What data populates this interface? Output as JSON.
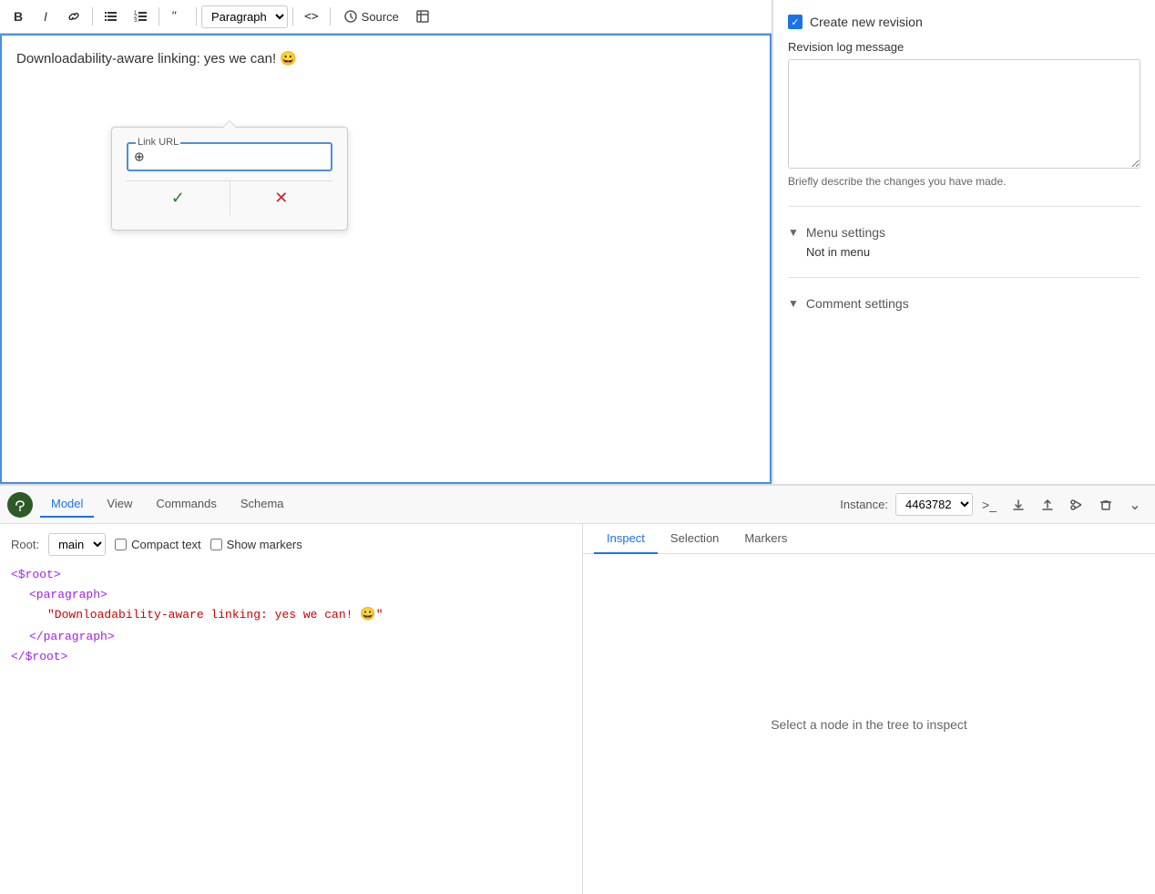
{
  "toolbar": {
    "bold_label": "B",
    "italic_label": "I",
    "link_label": "🔗",
    "bullet_list_label": "≡",
    "ordered_list_label": "≡↑",
    "blockquote_label": "❝",
    "paragraph_label": "Paragraph",
    "code_label": "<>",
    "source_label": "Source",
    "embed_label": "⊞"
  },
  "editor": {
    "content_text": "Downloadability-aware linking: yes we can! 😀",
    "link_url_label": "Link URL",
    "link_url_placeholder": "",
    "confirm_label": "✓",
    "cancel_label": "✕"
  },
  "sidebar": {
    "create_revision_label": "Create new revision",
    "revision_log_label": "Revision log message",
    "revision_hint": "Briefly describe the changes you have made.",
    "menu_settings_label": "Menu settings",
    "menu_not_in_menu": "Not in menu",
    "comment_settings_label": "Comment settings"
  },
  "bottom_panel": {
    "tabs": [
      {
        "label": "Model",
        "active": true
      },
      {
        "label": "View",
        "active": false
      },
      {
        "label": "Commands",
        "active": false
      },
      {
        "label": "Schema",
        "active": false
      }
    ],
    "instance_label": "Instance:",
    "instance_value": "4463782",
    "icons": {
      "terminal": ">_",
      "download": "⬇",
      "upload": "⬆",
      "scissors": "✂",
      "trash": "🗑",
      "expand": "⌄"
    }
  },
  "tree_panel": {
    "root_label": "Root:",
    "root_value": "main",
    "compact_text_label": "Compact text",
    "show_markers_label": "Show markers",
    "tree_content": {
      "root_open": "<$root>",
      "paragraph_open": "<paragraph>",
      "text_content": "\"Downloadability-aware linking: yes we can! 😀\"",
      "paragraph_close": "</paragraph>",
      "root_close": "</$root>"
    }
  },
  "inspect_panel": {
    "tabs": [
      {
        "label": "Inspect",
        "active": true
      },
      {
        "label": "Selection",
        "active": false
      },
      {
        "label": "Markers",
        "active": false
      }
    ],
    "placeholder": "Select a node in the tree to inspect"
  }
}
